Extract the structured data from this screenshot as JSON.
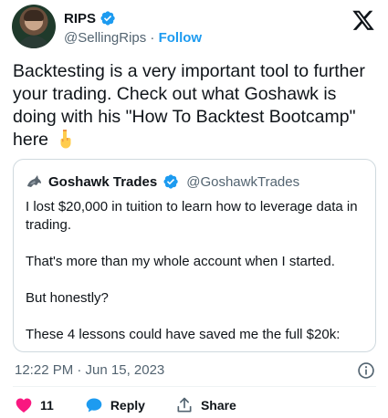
{
  "author": {
    "display_name": "RIPS",
    "handle": "@SellingRips",
    "separator": " · ",
    "follow_label": "Follow"
  },
  "icons": {
    "verified": "verified-badge-icon",
    "platform": "x-logo-icon",
    "emoji": "backhand-index-pointing-down-icon",
    "info": "info-circle-icon",
    "like": "heart-icon",
    "reply": "speech-bubble-icon",
    "share": "share-upload-icon"
  },
  "tweet": {
    "text": "Backtesting is a very important tool to further your trading. Check out what Goshawk is doing with his \"How To Backtest Bootcamp\" here"
  },
  "quoted": {
    "display_name": "Goshawk Trades",
    "handle": "@GoshawkTrades",
    "paragraphs": [
      "I lost $20,000 in tuition to learn how to leverage data in trading.",
      "That's more than my whole account when I started.",
      "But honestly?",
      "These 4 lessons could have saved me the full $20k:"
    ]
  },
  "meta": {
    "timestamp": "12:22 PM · Jun 15, 2023"
  },
  "actions": {
    "like_count": "11",
    "reply_label": "Reply",
    "share_label": "Share"
  },
  "colors": {
    "accent": "#1d9bf0",
    "like": "#f91880",
    "muted": "#536471",
    "text": "#0f1419",
    "border": "#cfd9de"
  }
}
